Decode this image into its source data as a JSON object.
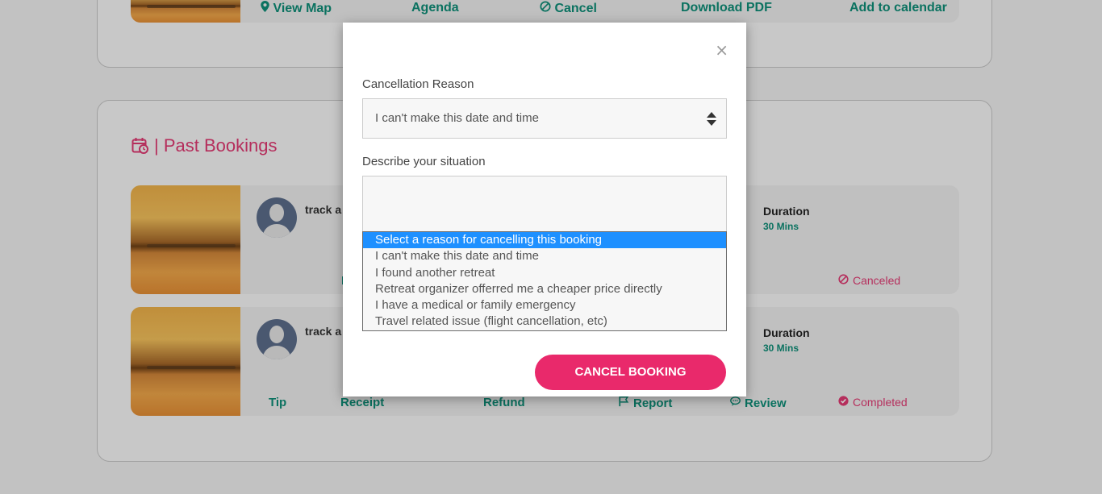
{
  "upcoming": {
    "actions": [
      {
        "label": "View Map",
        "icon": "map-marker-icon"
      },
      {
        "label": "Agenda"
      },
      {
        "label": "Cancel",
        "icon": "ban-icon"
      },
      {
        "label": "Download PDF"
      },
      {
        "label": "Add to calendar"
      }
    ]
  },
  "past": {
    "title": "| Past Bookings",
    "bookings": [
      {
        "title": "track a",
        "duration_label": "Duration",
        "duration_value": "30 Mins",
        "status": "Canceled",
        "status_icon": "ban-icon",
        "visible_action_fragment": "I"
      },
      {
        "title": "track a",
        "duration_label": "Duration",
        "duration_value": "30 Mins",
        "status": "Completed",
        "status_icon": "check-circle-icon",
        "actions": [
          {
            "label": "Tip"
          },
          {
            "label": "Receipt"
          },
          {
            "label": "Refund"
          },
          {
            "label": "Report",
            "icon": "flag-icon"
          },
          {
            "label": "Review",
            "icon": "comment-icon"
          }
        ]
      }
    ]
  },
  "modal": {
    "close_label": "×",
    "reason_label": "Cancellation Reason",
    "reason_value": "I can't make this date and time",
    "describe_label": "Describe your situation",
    "options": [
      "Select a reason for cancelling this booking",
      "I can't make this date and time",
      "I found another retreat",
      "Retreat organizer offerred me a cheaper price directly",
      "I have a medical or family emergency",
      "Travel related issue (flight cancellation, etc)"
    ],
    "highlighted_option_index": 0,
    "submit_label": "CANCEL BOOKING"
  },
  "colors": {
    "accent_pink": "#e9296b",
    "title_pink": "#e33a73",
    "link_teal": "#0e8f79",
    "highlight_blue": "#1e90ff"
  }
}
